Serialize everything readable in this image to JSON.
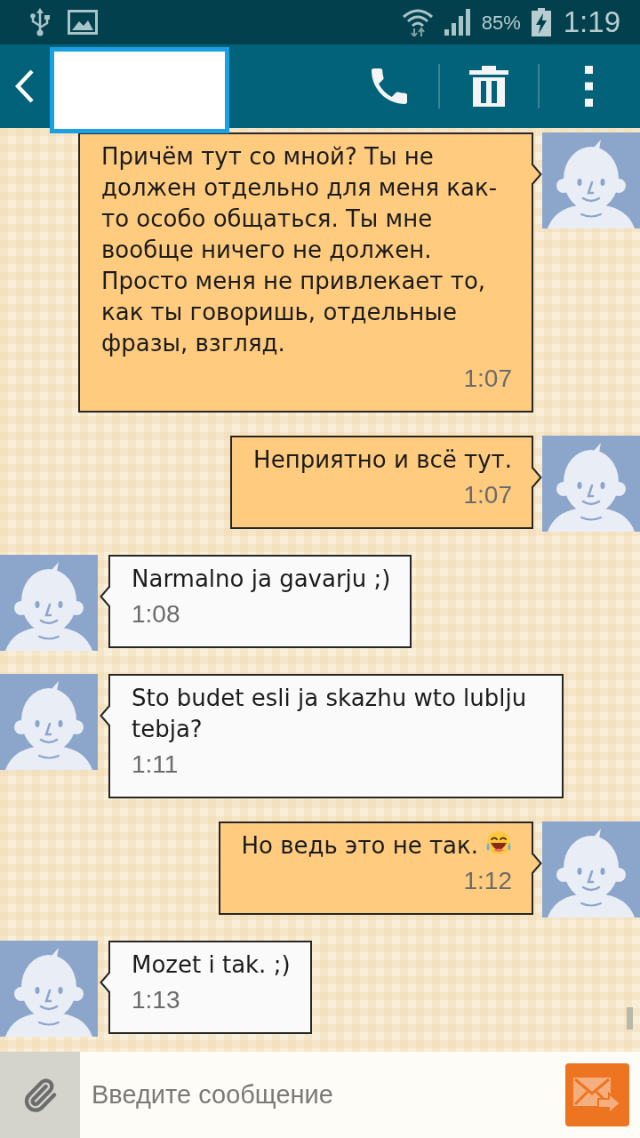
{
  "status_bar": {
    "battery": "85%",
    "time": "1:19"
  },
  "messages": [
    {
      "kind": "sent",
      "text": "Причём тут со мной? Ты не должен отдельно для меня как-то особо общаться. Ты мне вообще ничего не должен. Просто меня не привлекает то, как ты говоришь, отдельные фразы, взгляд.",
      "time": "1:07",
      "trailing_emoji": false
    },
    {
      "kind": "sent",
      "text": "Неприятно и всё тут.",
      "time": "1:07",
      "trailing_emoji": false
    },
    {
      "kind": "received",
      "text": "Narmalno ja gavarju ;)",
      "time": "1:08",
      "trailing_emoji": false
    },
    {
      "kind": "received",
      "text": "Sto budet esli ja skazhu wto lublju tebja?",
      "time": "1:11",
      "trailing_emoji": false
    },
    {
      "kind": "sent",
      "text": "Но ведь это не так.",
      "time": "1:12",
      "trailing_emoji": true
    },
    {
      "kind": "received",
      "text": "Mozet i tak. ;)",
      "time": "1:13",
      "trailing_emoji": false
    }
  ],
  "composer": {
    "placeholder": "Введите сообщение"
  }
}
